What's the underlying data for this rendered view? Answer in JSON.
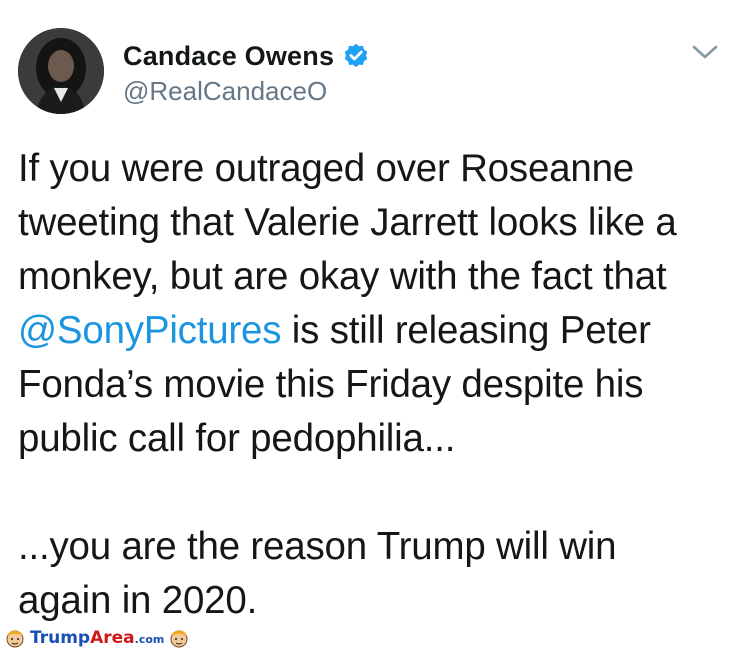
{
  "tweet": {
    "author": {
      "display_name": "Candace Owens",
      "handle": "@RealCandaceO",
      "verified": true,
      "avatar_icon": "profile-photo"
    },
    "menu_icon": "chevron-down-icon",
    "text": {
      "line1": "If you were outraged over Roseanne",
      "line2": "tweeting that Valerie Jarrett looks like a",
      "line3": "monkey, but are okay with the fact that",
      "mention": "@SonyPictures",
      "line4_rest": " is still releasing Peter",
      "line5": "Fonda’s movie this Friday despite his",
      "line6": "public call for pedophilia...",
      "line7": "...you are the reason Trump will win",
      "line8": "again in 2020."
    }
  },
  "watermark": {
    "part1": "Trump",
    "part2": "Area",
    "part3": ".com"
  },
  "colors": {
    "text": "#14171a",
    "secondary_text": "#657786",
    "link": "#1b95e0",
    "verified_badge": "#1da1f2"
  }
}
